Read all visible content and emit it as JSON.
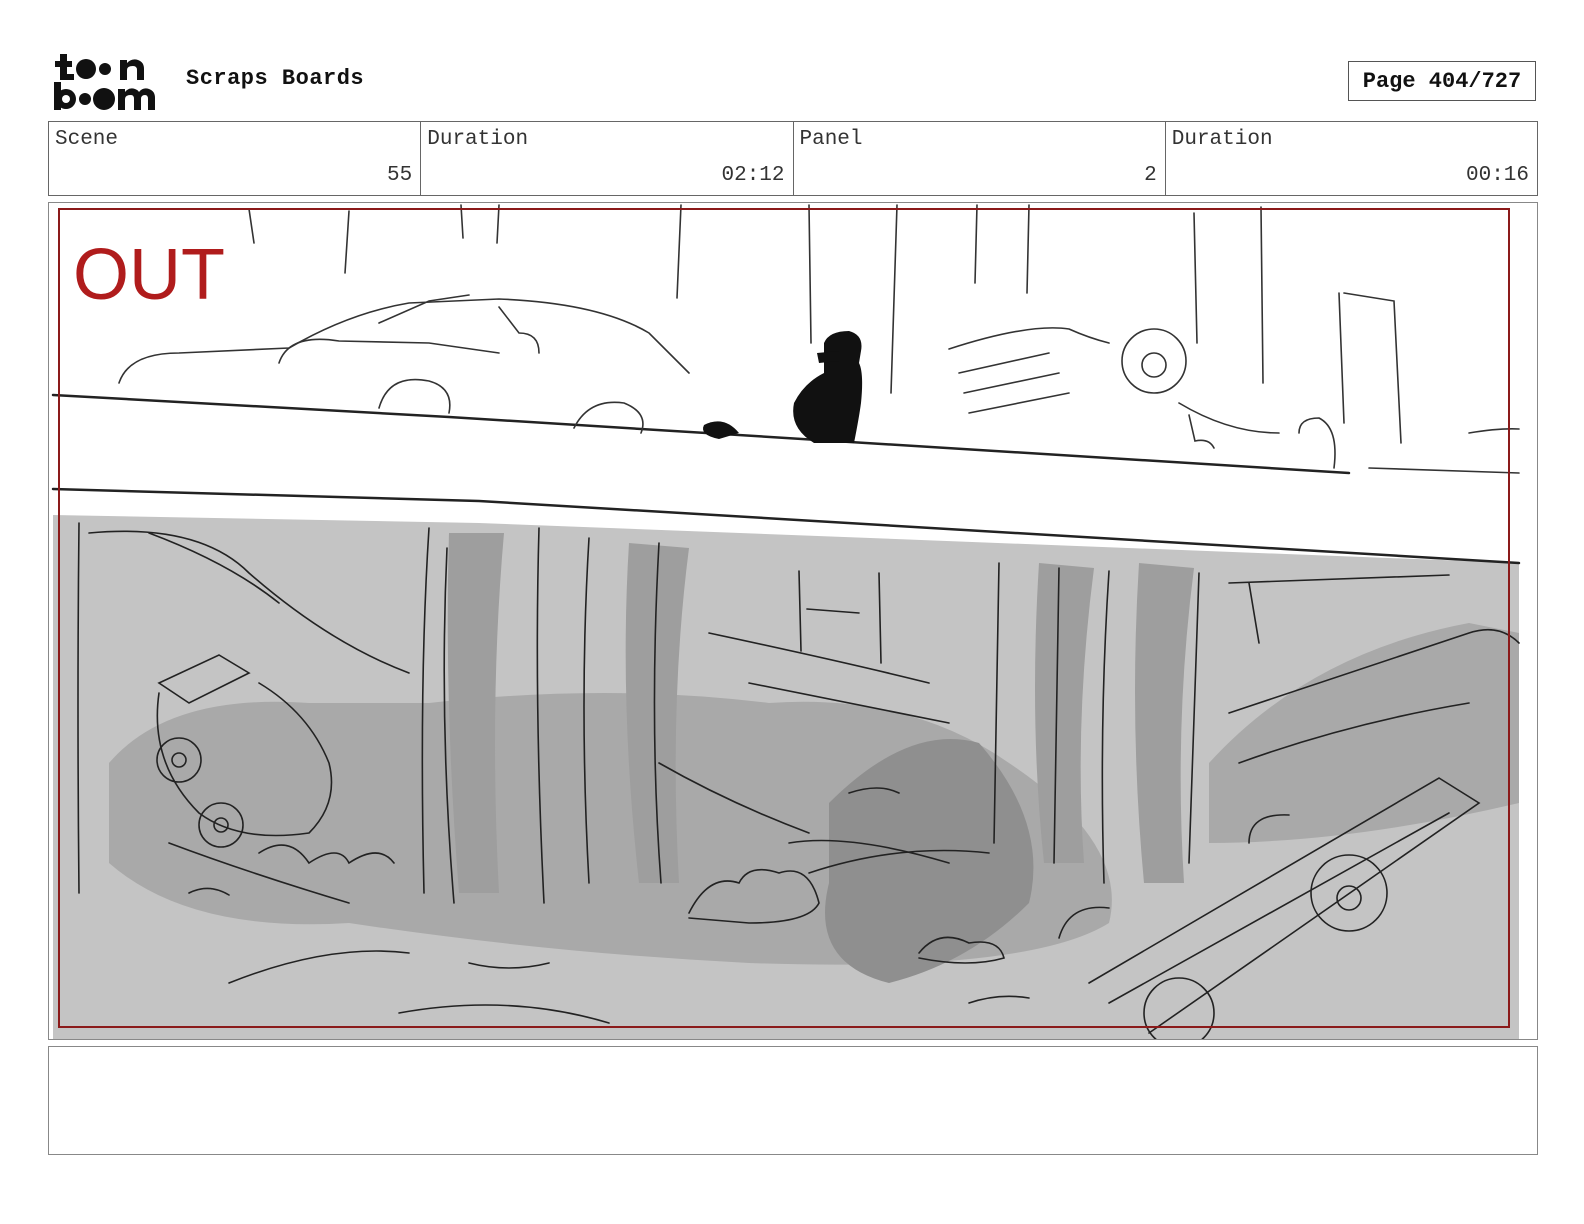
{
  "header": {
    "logo_text_top": "toon",
    "logo_text_bottom": "boom",
    "project_title": "Scraps Boards",
    "page_label": "Page 404/727"
  },
  "info": {
    "scene_label": "Scene",
    "scene_value": "55",
    "scene_duration_label": "Duration",
    "scene_duration_value": "02:12",
    "panel_label": "Panel",
    "panel_value": "2",
    "panel_duration_label": "Duration",
    "panel_duration_value": "00:16"
  },
  "panel": {
    "overlay_text": "OUT",
    "overlay_color": "#b01c1c"
  },
  "notes": {
    "text": ""
  }
}
